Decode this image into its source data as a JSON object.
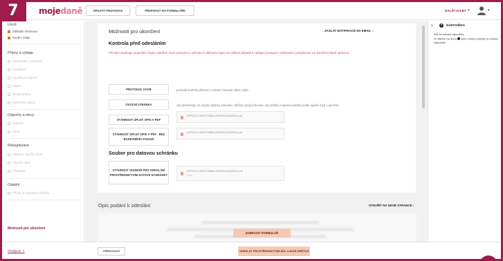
{
  "step_number": "7",
  "logo": {
    "part1": "moje",
    "part2": "daně"
  },
  "header": {
    "guide_button": "SPUSTIT PRŮVODCE",
    "forms_button": "PŘEPNOUT DO FORMULÁŘE",
    "more_options": "DALŠÍ VOLBY",
    "avatar_icon": "user-icon"
  },
  "sidebar": {
    "sections": [
      {
        "title": "Úvod",
        "items": [
          {
            "label": "Základní informace",
            "done": true
          },
          {
            "label": "Osobní údaje",
            "done": true
          }
        ]
      },
      {
        "title": "Příjmy a výdaje",
        "items": [
          {
            "label": "Zaměstnání, prognóza",
            "done": false
          },
          {
            "label": "Podnikání",
            "done": false
          },
          {
            "label": "Kapitálový majetek",
            "done": false
          },
          {
            "label": "Nájem",
            "done": false
          },
          {
            "label": "Ostatní příjmy",
            "done": false
          },
          {
            "label": "Zahraniční příjmy",
            "done": false
          }
        ]
      },
      {
        "title": "Odpočty a slevy",
        "items": [
          {
            "label": "Odpočty",
            "done": false
          },
          {
            "label": "Slevy",
            "done": false
          }
        ]
      },
      {
        "title": "Rekapitulace",
        "items": [
          {
            "label": "Základ a výpočet daně",
            "done": false
          },
          {
            "label": "Výpočet daně",
            "done": false
          },
          {
            "label": "Přeplatek",
            "done": false
          }
        ]
      },
      {
        "title": "Ostatní",
        "items": [
          {
            "label": "Přílohy a podpisové doložky",
            "done": false
          }
        ]
      }
    ],
    "active_item": "Možnosti pro ukončení"
  },
  "main": {
    "card_title": "Možnosti pro ukončení",
    "notify_link": "ZASLAT NOTIFIKACE NA EMAIL ›",
    "check_title": "Kontrola před odesláním",
    "warning": "Přiznání obsahuje propustné chyby zdaněné, které pomohou u přiznání k daňovém tipeni ve většině případů k zahájení postupu k odstranění pochybností a k doměření daně opravení.",
    "actions": [
      {
        "label": "PROTOKOL CHYB",
        "desc": "provede kontrolu přiznání a zobrazí seznam všech chyb."
      },
      {
        "label": "OVOCNÍ STRÁNKA",
        "desc": "vás přesměruje na úvodní stránku průvodce. Můžete projít průvodce od počátku a opravit položky podle výpisů chyb u položek."
      }
    ],
    "downloads": [
      {
        "label": "STÁHNOUT ÚPLNÝ OPIS V PDF",
        "file": "DPFDC1-9007270866-20230316-090912.pdf"
      },
      {
        "label": "STÁHNOUT ÚPLNÝ OPIS V PDF - BEZ BAREVNÉHO POZADÍ",
        "file": "DPFDC1-9007270866-20230316-090912.pdf"
      }
    ],
    "databox_title": "Soubor pro datovou schránku",
    "databox": {
      "label": "STÁHNOUT SOUBOR PRO ODESLÁNÍ PROSTŘEDNICTVÍM DATOVÉ SCHRÁNKY",
      "file": "DPFDC1-9007270866-20230316-090912.xml",
      "size": "5 kB"
    },
    "preview_title": "Opis podání k odeslání",
    "open_new": "OTEVŘÍT NA NOVÉ STRÁNCE ›",
    "show_form": "ZOBRAZIT FORMULÁŘ"
  },
  "help": {
    "title": "NÁPOVĚDA",
    "line1": "Zde se zobrazí nápověda",
    "line2a": "Po kliknutí na ikonu",
    "line2b": "nebo zvolení položky se zobrazí nápověda"
  },
  "footer": {
    "epodpora": "ePodpora",
    "prev": "PŘEDCHOZÍ",
    "send": "ODESLAT PROSTŘEDNICTVÍM EID• LUKÁŠ HEŘTUS"
  },
  "colors": {
    "brand": "#9e1b4b",
    "accent": "#e86a1f",
    "warning": "#d9455f",
    "cta": "#f6c9b6"
  }
}
